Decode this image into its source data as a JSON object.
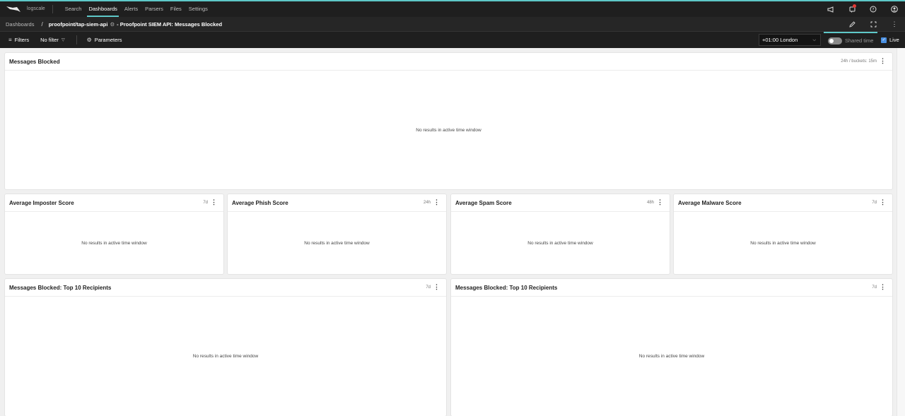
{
  "nav": {
    "brand": "logscale",
    "links": [
      "Search",
      "Dashboards",
      "Alerts",
      "Parsers",
      "Files",
      "Settings"
    ]
  },
  "breadcrumb": {
    "root": "Dashboards",
    "separator": "/",
    "package": "proofpoint/tap-siem-api",
    "title": "- Proofpoint SIEM API: Messages Blocked"
  },
  "filterbar": {
    "filters_label": "Filters",
    "nofilter_label": "No filter",
    "parameters_label": "Parameters",
    "timezone": "+01:00 London",
    "shared_time_label": "Shared time",
    "live_label": "Live"
  },
  "widgets": [
    {
      "title": "Messages Blocked",
      "meta": "24h / buckets: 15m",
      "empty": "No results in active time window"
    },
    {
      "title": "Average Imposter Score",
      "meta": "7d",
      "empty": "No results in active time window"
    },
    {
      "title": "Average Phish Score",
      "meta": "24h",
      "empty": "No results in active time window"
    },
    {
      "title": "Average Spam Score",
      "meta": "48h",
      "empty": "No results in active time window"
    },
    {
      "title": "Average Malware Score",
      "meta": "7d",
      "empty": "No results in active time window"
    },
    {
      "title": "Messages Blocked: Top 10 Recipients",
      "meta": "7d",
      "empty": "No results in active time window"
    },
    {
      "title": "Messages Blocked: Top 10 Recipients",
      "meta": "7d",
      "empty": "No results in active time window"
    }
  ],
  "colors": {
    "accent": "#5ec8c8",
    "nav_bg": "#1f1f1f",
    "notification": "#e53935",
    "checkbox": "#4a90e2"
  }
}
